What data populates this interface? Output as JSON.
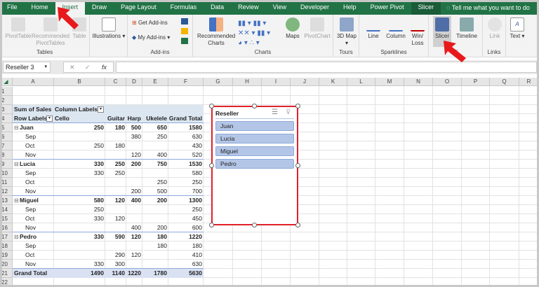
{
  "tabs": [
    "File",
    "Home",
    "Insert",
    "Draw",
    "Page Layout",
    "Formulas",
    "Data",
    "Review",
    "View",
    "Developer",
    "Help",
    "Power Pivot",
    "Slicer"
  ],
  "active_tab": "Insert",
  "tell_me": "Tell me what you want to do",
  "ribbon": {
    "tables": {
      "label": "Tables",
      "pivottable": "PivotTable",
      "recommended": "Recommended PivotTables",
      "table": "Table"
    },
    "illustrations": "Illustrations",
    "addins": {
      "label": "Add-ins",
      "get": "Get Add-ins",
      "my": "My Add-ins"
    },
    "charts": {
      "label": "Charts",
      "recommended": "Recommended Charts",
      "maps": "Maps",
      "pivotchart": "PivotChart"
    },
    "tours": {
      "label": "Tours",
      "map3d": "3D Map"
    },
    "sparklines": {
      "label": "Sparklines",
      "line": "Line",
      "column": "Column",
      "winloss": "Win/ Loss"
    },
    "filters": {
      "label": "Fi",
      "slicer": "Slicer",
      "timeline": "Timeline"
    },
    "links": {
      "label": "Links",
      "link": "Link"
    },
    "text": "Text"
  },
  "formula_bar": {
    "name_box": "Reseller 3",
    "fx": "fx",
    "cancel": "✕",
    "enter": "✓",
    "value": ""
  },
  "columns": [
    "A",
    "B",
    "C",
    "D",
    "E",
    "F",
    "G",
    "H",
    "I",
    "J",
    "K",
    "L",
    "M",
    "N",
    "O",
    "P",
    "Q",
    "R"
  ],
  "rows": [
    "1",
    "2",
    "3",
    "4",
    "5",
    "6",
    "7",
    "8",
    "9",
    "10",
    "11",
    "12",
    "13",
    "14",
    "15",
    "16",
    "17",
    "18",
    "19",
    "20",
    "21",
    "22"
  ],
  "pivot": {
    "title": "Sum of  Sales",
    "column_labels": "Column Labels",
    "row_labels": "Row Labels",
    "headers": [
      "Cello",
      "Guitar",
      "Harp",
      "Ukelele",
      "Grand Total"
    ],
    "body": [
      {
        "label": "Juan",
        "level": 0,
        "values": [
          "250",
          "180",
          "500",
          "650",
          "1580"
        ]
      },
      {
        "label": "Sep",
        "level": 1,
        "values": [
          "",
          "",
          "380",
          "250",
          "630"
        ]
      },
      {
        "label": "Oct",
        "level": 1,
        "values": [
          "250",
          "180",
          "",
          "",
          "430"
        ]
      },
      {
        "label": "Nov",
        "level": 1,
        "values": [
          "",
          "",
          "120",
          "400",
          "520"
        ]
      },
      {
        "label": "Lucia",
        "level": 0,
        "values": [
          "330",
          "250",
          "200",
          "750",
          "1530"
        ]
      },
      {
        "label": "Sep",
        "level": 1,
        "values": [
          "330",
          "250",
          "",
          "",
          "580"
        ]
      },
      {
        "label": "Oct",
        "level": 1,
        "values": [
          "",
          "",
          "",
          "250",
          "250"
        ]
      },
      {
        "label": "Nov",
        "level": 1,
        "values": [
          "",
          "",
          "200",
          "500",
          "700"
        ]
      },
      {
        "label": "Miguel",
        "level": 0,
        "values": [
          "580",
          "120",
          "400",
          "200",
          "1300"
        ]
      },
      {
        "label": "Sep",
        "level": 1,
        "values": [
          "250",
          "",
          "",
          "",
          "250"
        ]
      },
      {
        "label": "Oct",
        "level": 1,
        "values": [
          "330",
          "120",
          "",
          "",
          "450"
        ]
      },
      {
        "label": "Nov",
        "level": 1,
        "values": [
          "",
          "",
          "400",
          "200",
          "600"
        ]
      },
      {
        "label": "Pedro",
        "level": 0,
        "values": [
          "330",
          "590",
          "120",
          "180",
          "1220"
        ]
      },
      {
        "label": "Sep",
        "level": 1,
        "values": [
          "",
          "",
          "",
          "180",
          "180"
        ]
      },
      {
        "label": "Oct",
        "level": 1,
        "values": [
          "",
          "290",
          "120",
          "",
          "410"
        ]
      },
      {
        "label": "Nov",
        "level": 1,
        "values": [
          "330",
          "300",
          "",
          "",
          "630"
        ]
      }
    ],
    "grand_total": {
      "label": "Grand Total",
      "values": [
        "1490",
        "1140",
        "1220",
        "1780",
        "5630"
      ]
    }
  },
  "slicer": {
    "title": "Reseller",
    "items": [
      "Juan",
      "Lucia",
      "Miguel",
      "Pedro"
    ]
  },
  "colors": {
    "excel_green": "#217346",
    "slicer_item": "#b4c6e7",
    "highlight": "#e0202a",
    "pivot_header": "#dce6f1"
  }
}
